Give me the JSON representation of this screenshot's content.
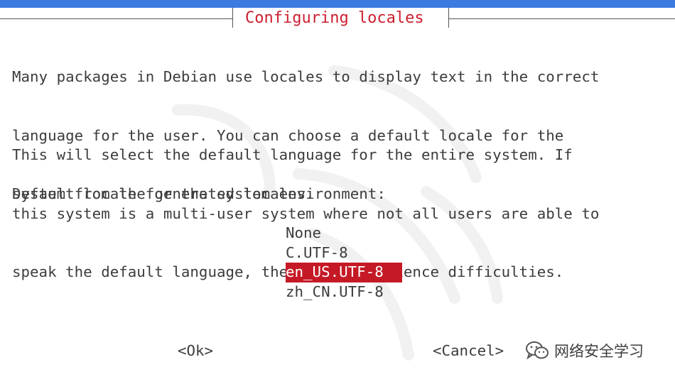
{
  "window": {
    "title": "Configuring locales"
  },
  "description": {
    "paragraph1": [
      "Many packages in Debian use locales to display text in the correct",
      "language for the user. You can choose a default locale for the",
      "system from the generated locales."
    ],
    "paragraph2": [
      "This will select the default language for the entire system. If",
      "this system is a multi-user system where not all users are able to",
      "speak the default language, they will experience difficulties."
    ],
    "prompt": "Default locale for the system environment:"
  },
  "locales": {
    "selected": "en_US.UTF-8",
    "options": [
      "None",
      "C.UTF-8",
      "en_US.UTF-8",
      "zh_CN.UTF-8"
    ]
  },
  "buttons": {
    "ok_label": "<Ok>",
    "cancel_label": "<Cancel>"
  },
  "watermark": {
    "icon": "wechat-official-account-icon",
    "text": "网络安全学习"
  },
  "colors": {
    "title_text": "#cc1f2f",
    "selection_bg": "#c51a26",
    "selection_text": "#ffffff",
    "top_bar": "#3d7ae0",
    "body_text": "#3d3d3d"
  }
}
